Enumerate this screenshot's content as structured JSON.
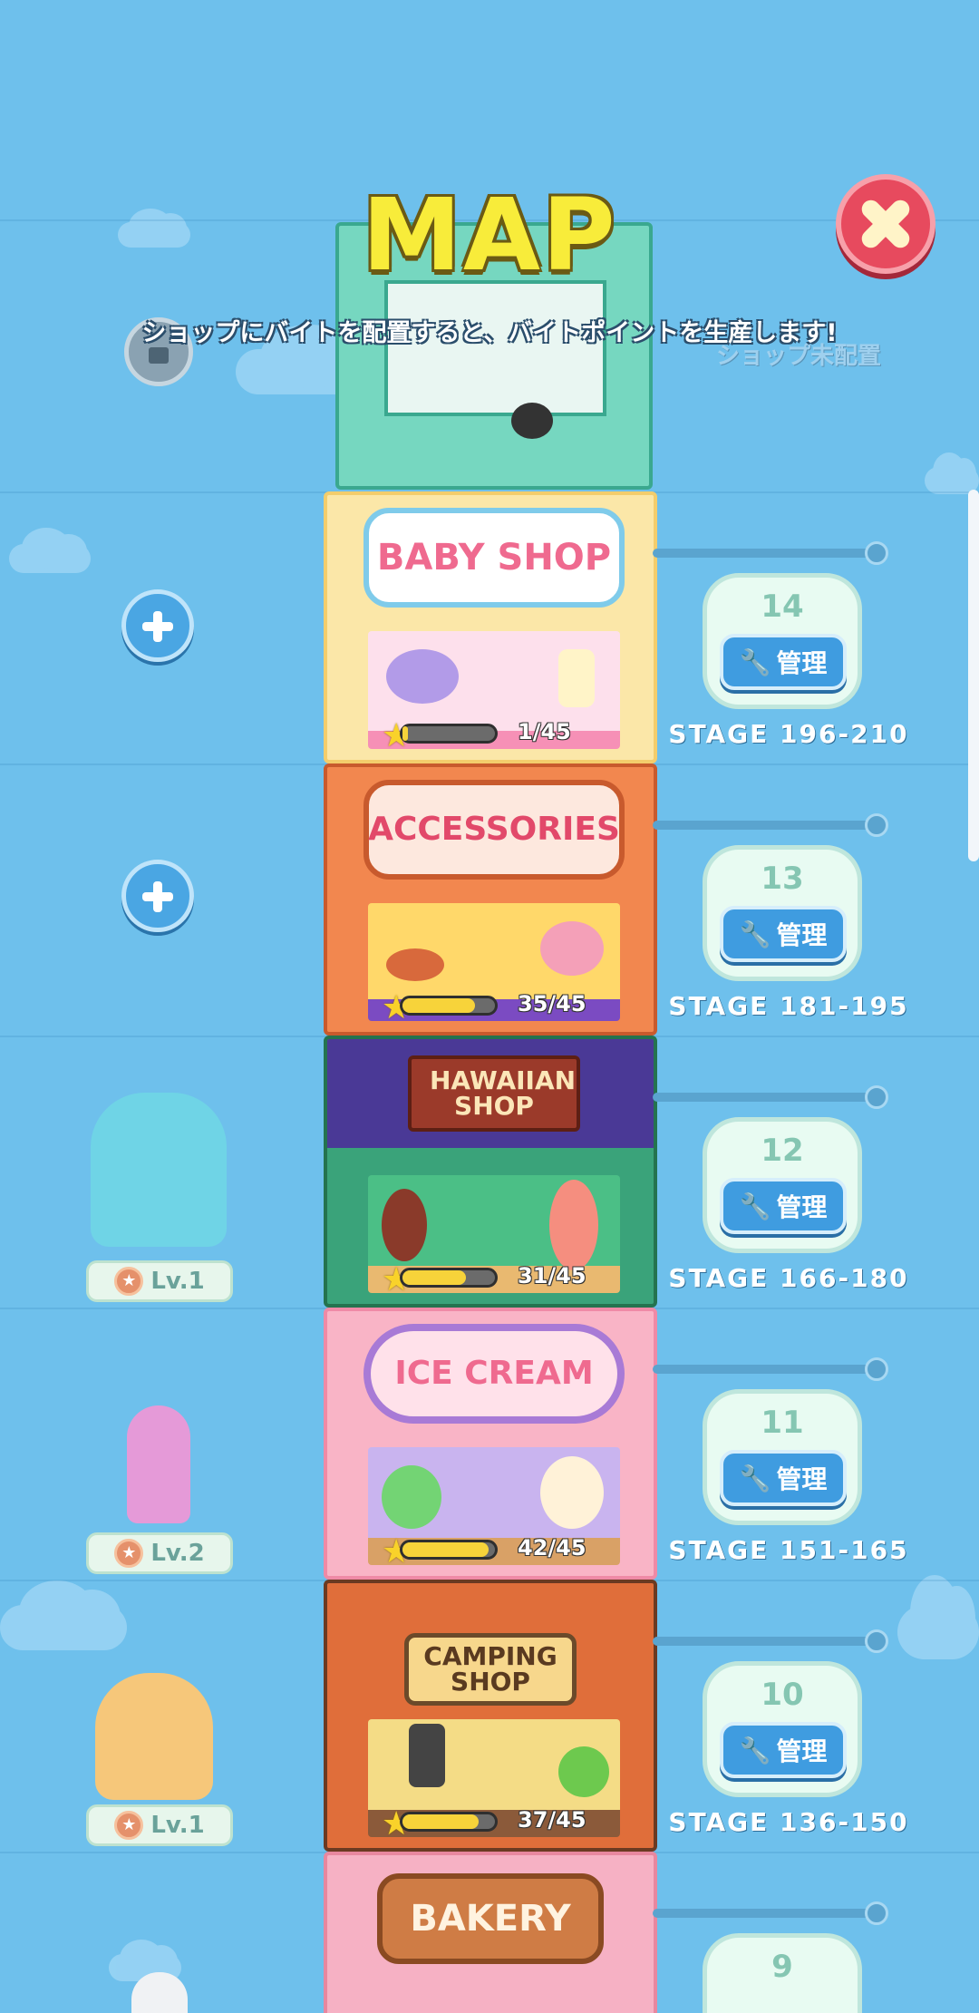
{
  "title": "MAP",
  "instruction": "ショップにバイトを配置すると、バイトポイントを生産します!",
  "unassigned_label": "ショップ未配置",
  "manage_label": "管理",
  "shops": [
    {
      "sign": "BABY SHOP",
      "count": "1/45",
      "progress": 0.03,
      "shop_no": "14",
      "stage": "STAGE 196-210"
    },
    {
      "sign": "ACCESSORIES",
      "count": "35/45",
      "progress": 0.78,
      "shop_no": "13",
      "stage": "STAGE 181-195"
    },
    {
      "sign": "HAWAIIAN SHOP",
      "count": "31/45",
      "progress": 0.69,
      "shop_no": "12",
      "stage": "STAGE 166-180"
    },
    {
      "sign": "ICE CREAM",
      "count": "42/45",
      "progress": 0.93,
      "shop_no": "11",
      "stage": "STAGE 151-165"
    },
    {
      "sign": "CAMPING SHOP",
      "count": "37/45",
      "progress": 0.82,
      "shop_no": "10",
      "stage": "STAGE 136-150"
    },
    {
      "sign": "BAKERY",
      "shop_no": "9"
    }
  ],
  "characters": [
    {
      "level": "Lv.1"
    },
    {
      "level": "Lv.2"
    },
    {
      "level": "Lv.1"
    }
  ],
  "icons": {
    "close": "close-icon",
    "add": "plus-icon",
    "lock": "lock-icon",
    "star": "star-icon",
    "wrench": "wrench-icon"
  }
}
